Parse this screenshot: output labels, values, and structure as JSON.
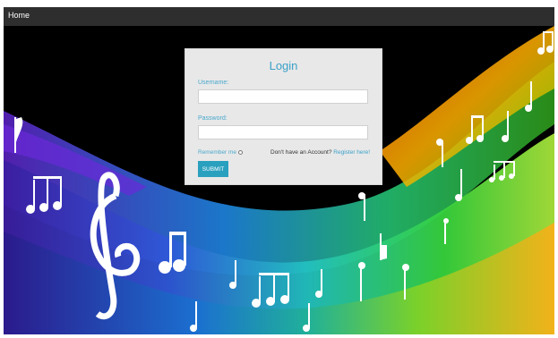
{
  "nav": {
    "home_label": "Home"
  },
  "login": {
    "title": "Login",
    "username_label": "Username:",
    "username_value": "",
    "password_label": "Password:",
    "password_value": "",
    "remember_label": "Remember me",
    "no_account_text": "Don't have an Account?",
    "register_link": "Register here!",
    "submit_label": "SUBMIT"
  },
  "colors": {
    "accent": "#3aa0c8",
    "navbar": "#2e2e2e",
    "card": "#e8e8e8",
    "submit": "#2aa0bf"
  },
  "background": {
    "description_icon": "music-notes-wave-icon"
  }
}
